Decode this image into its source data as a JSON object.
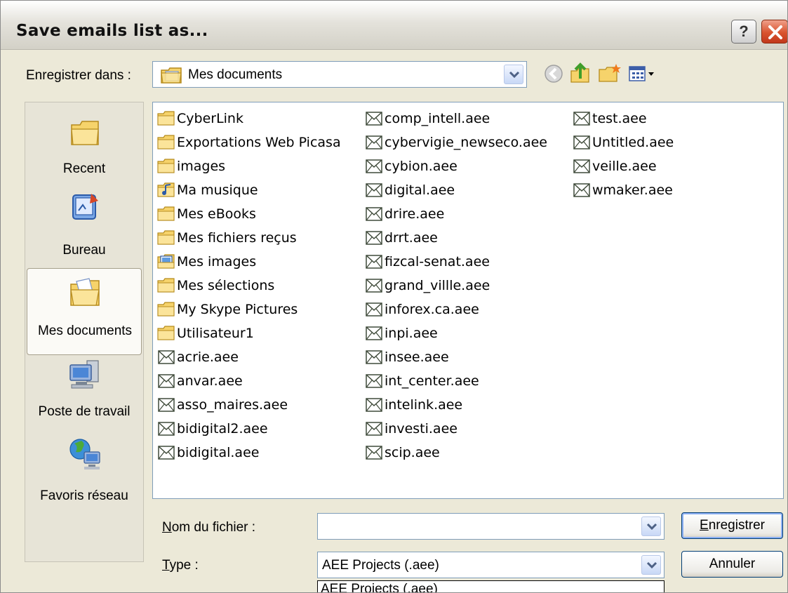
{
  "window": {
    "title": "Save emails list as...",
    "help_glyph": "?",
    "close_icon": "close-icon"
  },
  "save_in": {
    "label": "Enregistrer dans :",
    "label_underline": "d",
    "value": "Mes documents",
    "icon": "my-documents-icon"
  },
  "toolbar": {
    "icons": [
      "back-icon",
      "up-folder-icon",
      "new-folder-icon",
      "view-menu-icon"
    ]
  },
  "places": [
    {
      "label": "Recent",
      "icon": "recent-folder-icon"
    },
    {
      "label": "Bureau",
      "icon": "desktop-icon"
    },
    {
      "label": "Mes documents",
      "icon": "my-documents-icon",
      "selected": true
    },
    {
      "label": "Poste de travail",
      "icon": "my-computer-icon"
    },
    {
      "label": "Favoris réseau",
      "icon": "network-places-icon"
    }
  ],
  "files": {
    "column1": [
      {
        "name": "CyberLink",
        "type": "folder"
      },
      {
        "name": "Exportations Web Picasa",
        "type": "folder"
      },
      {
        "name": "images",
        "type": "folder"
      },
      {
        "name": "Ma musique",
        "type": "music-folder"
      },
      {
        "name": "Mes eBooks",
        "type": "folder"
      },
      {
        "name": "Mes fichiers reçus",
        "type": "folder"
      },
      {
        "name": "Mes images",
        "type": "pictures-folder"
      },
      {
        "name": "Mes sélections",
        "type": "folder"
      },
      {
        "name": "My Skype Pictures",
        "type": "folder"
      },
      {
        "name": "Utilisateur1",
        "type": "folder"
      },
      {
        "name": "acrie.aee",
        "type": "aee"
      },
      {
        "name": "anvar.aee",
        "type": "aee"
      },
      {
        "name": "asso_maires.aee",
        "type": "aee"
      },
      {
        "name": "bidigital2.aee",
        "type": "aee"
      },
      {
        "name": "bidigital.aee",
        "type": "aee"
      }
    ],
    "column2": [
      {
        "name": "comp_intell.aee",
        "type": "aee"
      },
      {
        "name": "cybervigie_newseco.aee",
        "type": "aee"
      },
      {
        "name": "cybion.aee",
        "type": "aee"
      },
      {
        "name": "digital.aee",
        "type": "aee"
      },
      {
        "name": "drire.aee",
        "type": "aee"
      },
      {
        "name": "drrt.aee",
        "type": "aee"
      },
      {
        "name": "fizcal-senat.aee",
        "type": "aee"
      },
      {
        "name": "grand_villle.aee",
        "type": "aee"
      },
      {
        "name": "inforex.ca.aee",
        "type": "aee"
      },
      {
        "name": "inpi.aee",
        "type": "aee"
      },
      {
        "name": "insee.aee",
        "type": "aee"
      },
      {
        "name": "int_center.aee",
        "type": "aee"
      },
      {
        "name": "intelink.aee",
        "type": "aee"
      },
      {
        "name": "investi.aee",
        "type": "aee"
      },
      {
        "name": "scip.aee",
        "type": "aee"
      }
    ],
    "column3": [
      {
        "name": "test.aee",
        "type": "aee"
      },
      {
        "name": "Untitled.aee",
        "type": "aee"
      },
      {
        "name": "veille.aee",
        "type": "aee"
      },
      {
        "name": "wmaker.aee",
        "type": "aee"
      }
    ]
  },
  "filename": {
    "label_first": "N",
    "label_rest": "om du fichier :",
    "value": ""
  },
  "filetype": {
    "label_first": "T",
    "label_rest": "ype :",
    "value": "AEE Projects (.aee)",
    "dropdown_option": "AEE Projects (.aee)"
  },
  "buttons": {
    "save_first": "E",
    "save_rest": "nregistrer",
    "cancel": "Annuler"
  },
  "colors": {
    "dialog_bg": "#ece9d8",
    "field_border": "#7f9db9",
    "folder_yellow": "#f6d36b",
    "close_red": "#d9532e"
  }
}
